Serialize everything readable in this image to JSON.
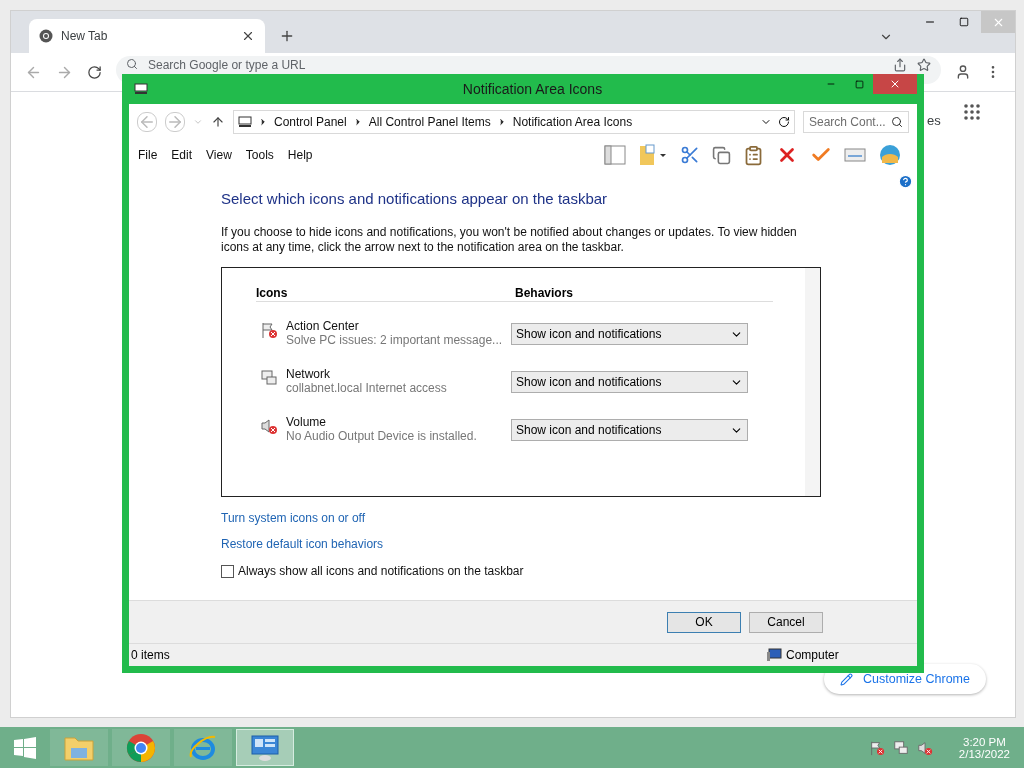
{
  "browser": {
    "tab": {
      "title": "New Tab"
    },
    "omnibox": {
      "placeholder": "Search Google or type a URL"
    },
    "partial_link": "es",
    "customize_button": "Customize Chrome"
  },
  "dialog": {
    "title": "Notification Area Icons",
    "breadcrumbs": [
      "Control Panel",
      "All Control Panel Items",
      "Notification Area Icons"
    ],
    "search": {
      "placeholder": "Search Cont..."
    },
    "menu": [
      "File",
      "Edit",
      "View",
      "Tools",
      "Help"
    ],
    "heading": "Select which icons and notifications appear on the taskbar",
    "description": "If you choose to hide icons and notifications, you won't be notified about changes or updates. To view hidden icons at any time, click the arrow next to the notification area on the taskbar.",
    "table": {
      "columns": [
        "Icons",
        "Behaviors"
      ],
      "rows": [
        {
          "kind": "flag",
          "name": "Action Center",
          "detail": "Solve PC issues: 2 important message...",
          "behavior": "Show icon and notifications"
        },
        {
          "kind": "network",
          "name": "Network",
          "detail": "collabnet.local Internet access",
          "behavior": "Show icon and notifications"
        },
        {
          "kind": "volume",
          "name": "Volume",
          "detail": "No Audio Output Device is installed.",
          "behavior": "Show icon and notifications"
        }
      ]
    },
    "links": [
      "Turn system icons on or off",
      "Restore default icon behaviors"
    ],
    "checkbox": {
      "label": "Always show all icons and notifications on the taskbar",
      "checked": false
    },
    "buttons": [
      "OK",
      "Cancel"
    ],
    "status_bar": {
      "items": "0 items",
      "zone": "Computer"
    }
  },
  "taskbar": {
    "apps": [
      {
        "kind": "explorer",
        "selected": false
      },
      {
        "kind": "chrome",
        "selected": false
      },
      {
        "kind": "ie",
        "selected": false
      },
      {
        "kind": "control-panel",
        "selected": true
      }
    ],
    "time": "3:20 PM",
    "date": "2/13/2022"
  }
}
